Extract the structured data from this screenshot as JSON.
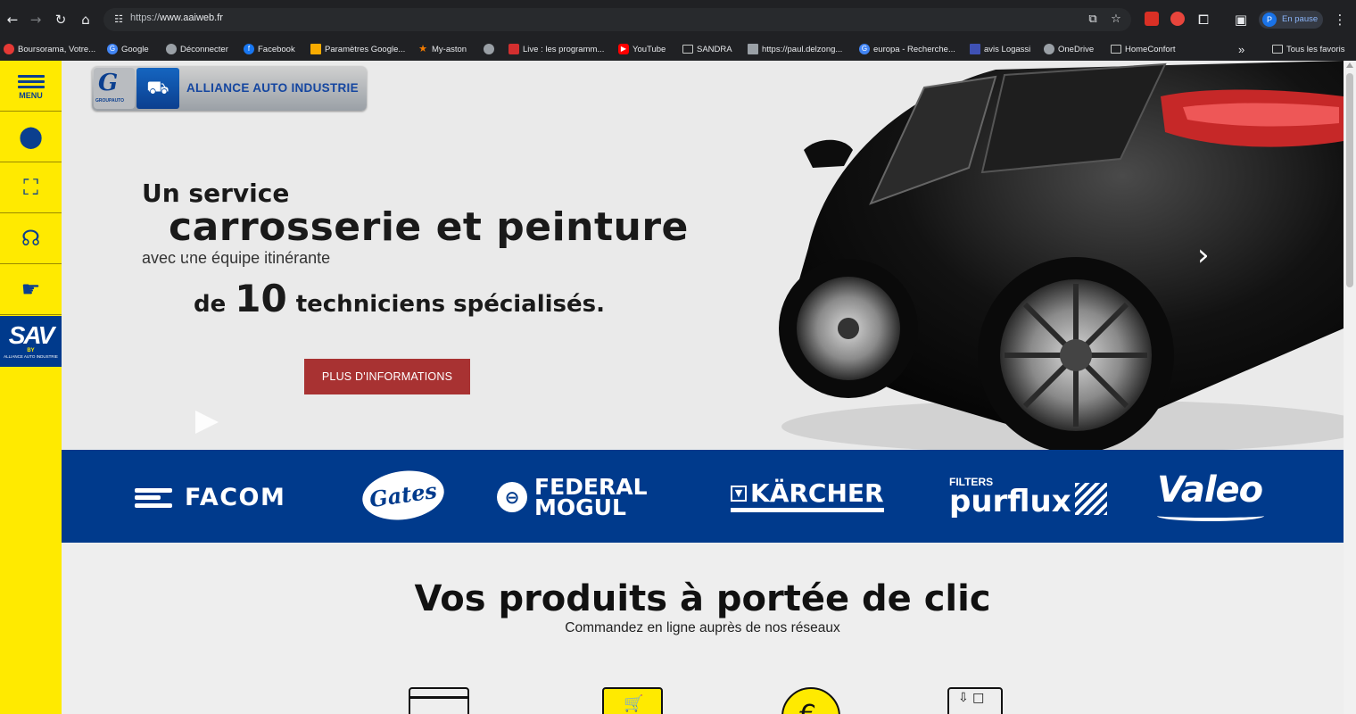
{
  "browser": {
    "url_prefix": "https://",
    "url_host": "www.aaiweb.fr",
    "profile_initial": "P",
    "profile_status": "En pause",
    "bookmarks": [
      {
        "label": "Boursorama, Votre...",
        "color": "#e53935"
      },
      {
        "label": "Google",
        "color": "#4285f4"
      },
      {
        "label": "Déconnecter",
        "color": "#9aa0a6"
      },
      {
        "label": "Facebook",
        "color": "#1877f2"
      },
      {
        "label": "Paramètres Google...",
        "color": "#f9ab00"
      },
      {
        "label": "My-aston",
        "color": "#f57c00"
      },
      {
        "label": "",
        "color": "#9aa0a6"
      },
      {
        "label": "Live : les programm...",
        "color": "#d32f2f"
      },
      {
        "label": "YouTube",
        "color": "#ff0000"
      },
      {
        "label": "SANDRA",
        "color": "folder"
      },
      {
        "label": "https://paul.delzong...",
        "color": "#9aa0a6"
      },
      {
        "label": "europa - Recherche...",
        "color": "#4285f4"
      },
      {
        "label": "avis Logassi",
        "color": "#3f51b5"
      },
      {
        "label": "OneDrive",
        "color": "#9aa0a6"
      },
      {
        "label": "HomeConfort",
        "color": "folder"
      }
    ],
    "overflow": "»",
    "all_bookmarks": "Tous les favoris"
  },
  "sidebar": {
    "menu_label": "MENU",
    "sav_big": "SAV",
    "sav_by": "BY",
    "sav_sub": "ALLIANCE AUTO INDUSTRIE",
    "icons": [
      "location-pin-icon",
      "face-scan-icon",
      "support-agent-icon",
      "click-hand-icon"
    ]
  },
  "logo": {
    "g_letter": "G",
    "groupauto": "GROUPAUTO",
    "name": "ALLIANCE AUTO INDUSTRIE"
  },
  "hero": {
    "line1": "Un service",
    "line2": "carrosserie et peinture",
    "line3": "avec une équipe itinérante",
    "line4_pre": "de",
    "line4_num": "10",
    "line4_post": "techniciens spécialisés.",
    "button": "PLUS D'INFORMATIONS"
  },
  "brands": {
    "facom": "FACOM",
    "gates": "Gates",
    "federal": "FEDERAL",
    "mogul": "MOGUL",
    "karcher": "KÄRCHER",
    "filters": "FILTERS",
    "purflux": "purflux",
    "valeo": "Valeo"
  },
  "products": {
    "title": "Vos produits à portée de clic",
    "subtitle": "Commandez en ligne auprès de nos réseaux"
  }
}
